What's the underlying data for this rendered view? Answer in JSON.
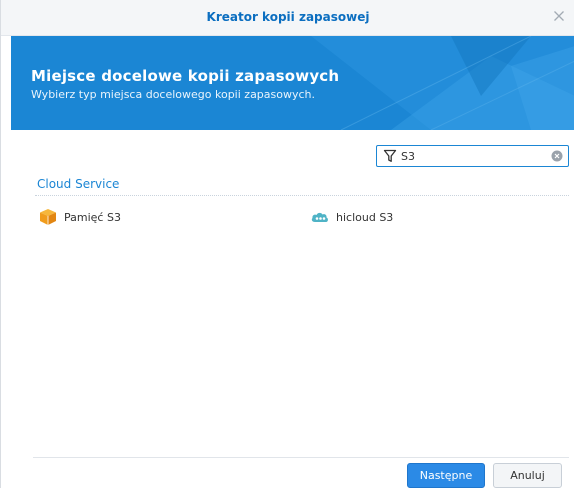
{
  "window": {
    "title": "Kreator kopii zapasowej",
    "close_icon": "close-icon"
  },
  "banner": {
    "heading": "Miejsce docelowe kopii zapasowych",
    "subheading": "Wybierz typ miejsca docelowego kopii zapasowych.",
    "color": "#1b86d4"
  },
  "filter": {
    "value": "S3",
    "icon": "filter-icon",
    "clear_icon": "clear-icon"
  },
  "section": {
    "title": "Cloud Service"
  },
  "destinations": [
    {
      "label": "Pamięć S3",
      "icon": "amazon-s3-icon"
    },
    {
      "label": "hicloud S3",
      "icon": "hicloud-icon"
    }
  ],
  "footer": {
    "next_label": "Następne",
    "cancel_label": "Anuluj",
    "accent": "#2b8ae6"
  }
}
